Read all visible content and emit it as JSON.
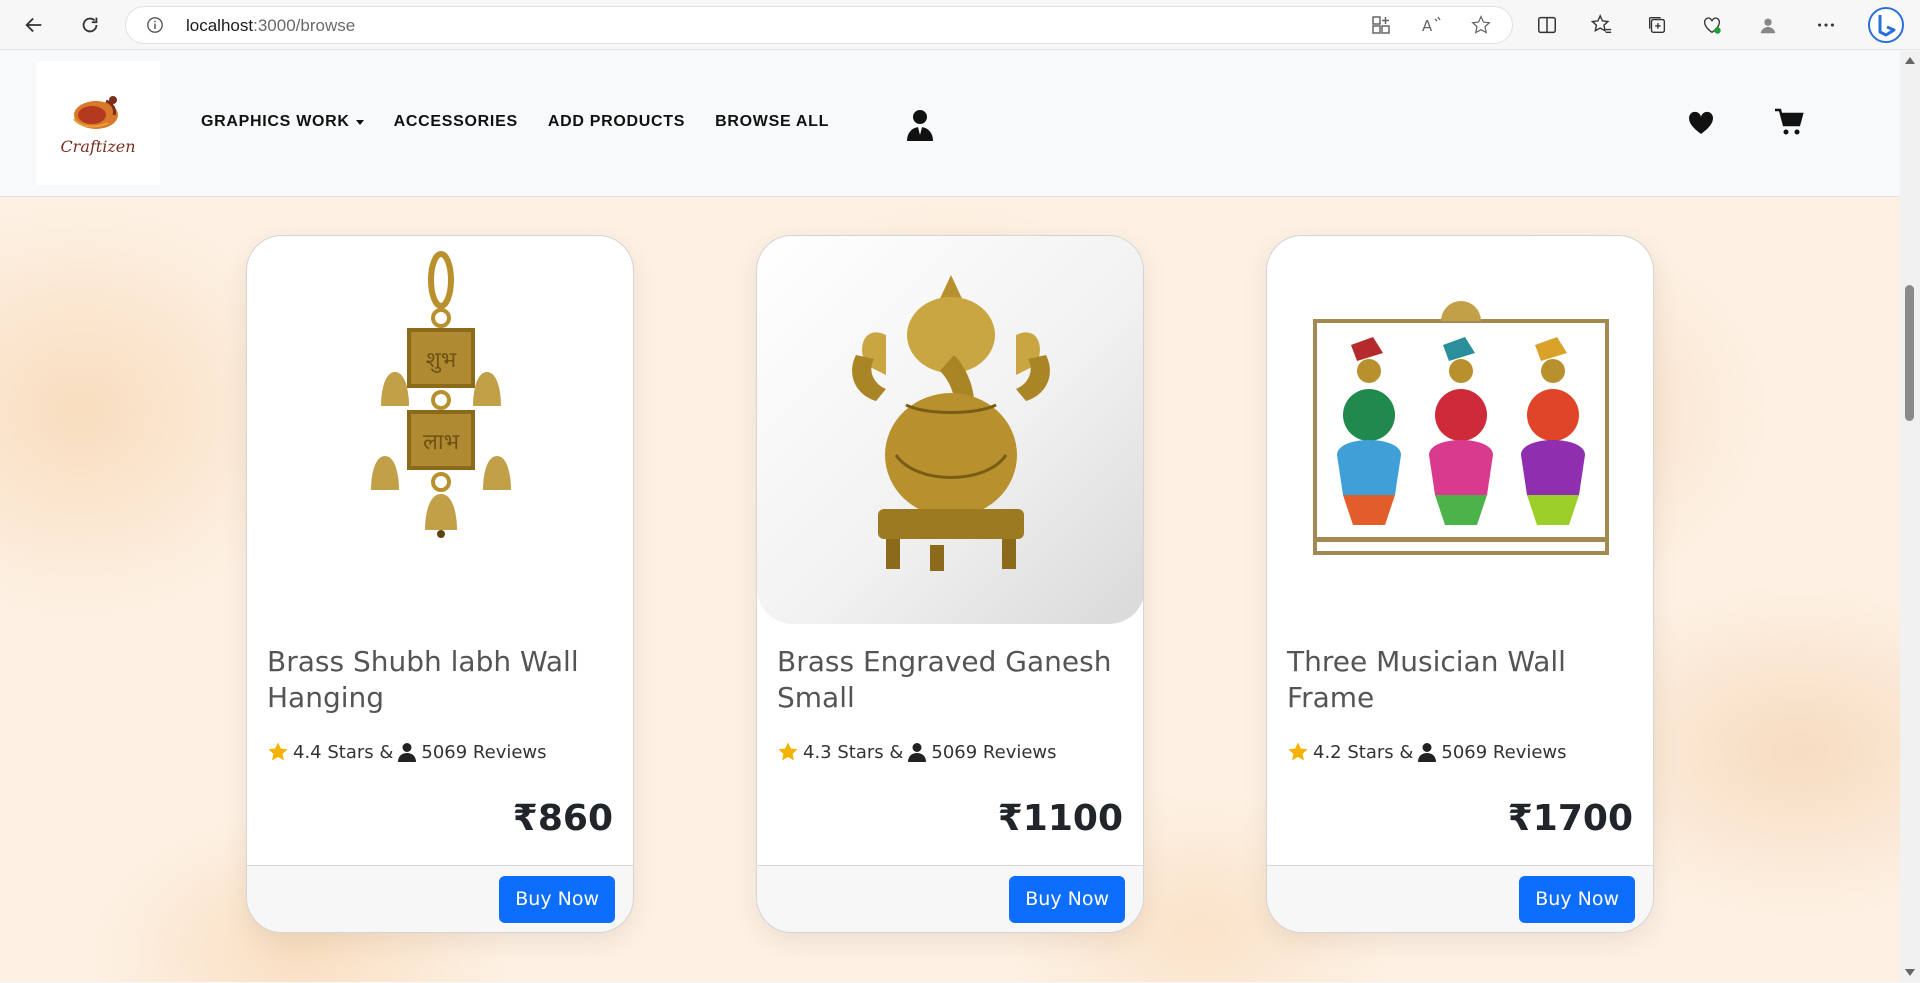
{
  "browser": {
    "url_host": "localhost",
    "url_path": ":3000/browse"
  },
  "navbar": {
    "logo_text": "Craftizen",
    "links": [
      {
        "label": "GRAPHICS WORK",
        "has_dropdown": true
      },
      {
        "label": "ACCESSORIES"
      },
      {
        "label": "ADD PRODUCTS"
      },
      {
        "label": "BROWSE ALL"
      }
    ]
  },
  "products": [
    {
      "title": "Brass Shubh labh Wall Hanging",
      "stars": "4.4 Stars &",
      "reviews": "5069 Reviews",
      "price": "₹860",
      "button": "Buy Now",
      "image_icon": "brass-bell-hanging"
    },
    {
      "title": "Brass Engraved Ganesh Small",
      "stars": "4.3 Stars &",
      "reviews": "5069 Reviews",
      "price": "₹1100",
      "button": "Buy Now",
      "image_icon": "brass-ganesh-statue"
    },
    {
      "title": "Three Musician Wall Frame",
      "stars": "4.2 Stars &",
      "reviews": "5069 Reviews",
      "price": "₹1700",
      "button": "Buy Now",
      "image_icon": "musician-wall-frame"
    }
  ],
  "colors": {
    "primary": "#0d6efd",
    "star": "#f5b301",
    "brass": "#b8912e"
  }
}
